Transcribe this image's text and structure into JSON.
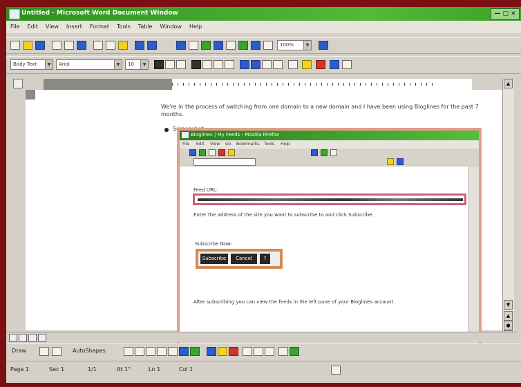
{
  "window": {
    "title": "Untitled - Microsoft Word Document Window"
  },
  "menu": [
    "File",
    "Edit",
    "View",
    "Insert",
    "Format",
    "Tools",
    "Table",
    "Window",
    "Help"
  ],
  "toolbar": {
    "zoom": "100%",
    "style": "Body Text",
    "font": "Arial",
    "font_size": "10"
  },
  "document": {
    "paragraph": "We're in the process of switching from one domain to a new domain and I have been using Bloglines for the past 7 months.",
    "bullet": "Screenshot:"
  },
  "embedded": {
    "title": "Bloglines | My Feeds - Mozilla Firefox",
    "menu": [
      "File",
      "Edit",
      "View",
      "Go",
      "Bookmarks",
      "Tools",
      "Help"
    ],
    "feeds_label": "Feed URL:",
    "instructions": "Enter the address of the site you want to subscribe to and click Subscribe.",
    "buttons_label": "Subscribe Now:",
    "buttons": [
      "Subscribe",
      "Cancel",
      "?"
    ],
    "footer_text": "After subscribing you can view the feeds in the left pane of your Bloglines account."
  },
  "drawing": {
    "draw_label": "Draw",
    "autoshapes_label": "AutoShapes"
  },
  "status": {
    "page": "Page 1",
    "sec": "Sec 1",
    "pos": "1/1",
    "at": "At 1\"",
    "ln": "Ln 1",
    "col": "Col 1"
  },
  "colors": {
    "titlebar": "#3aa228",
    "frame": "#7b0f12",
    "highlight_url": "#c8607a",
    "highlight_button": "#d58b56"
  }
}
